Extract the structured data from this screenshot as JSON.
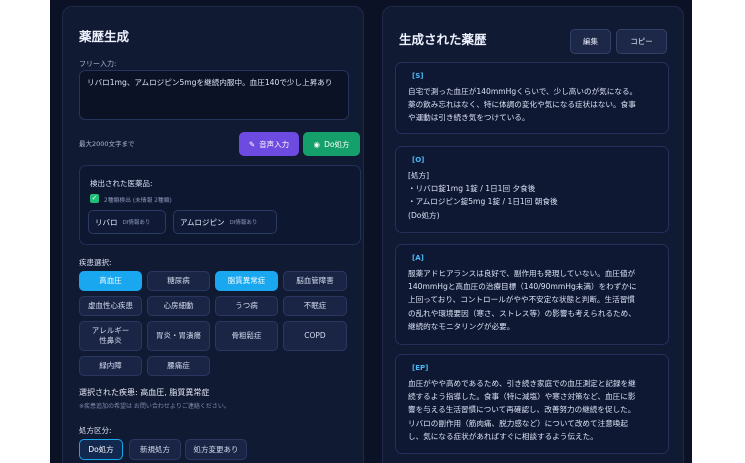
{
  "left_panel": {
    "title": "薬歴生成",
    "free_input_label": "フリー入力:",
    "free_input_value": "リバロ1mg、アムロジピン5mgを継続内服中。血圧140で少し上昇あり",
    "char_limit": "最大2000文字まで",
    "voice_button": "音声入力",
    "do_button": "Do処方",
    "detected_title": "検出された医薬品:",
    "detected_check_label": "2種類検出 (未情報 2種類)",
    "drugs": [
      {
        "name": "リバロ",
        "status": "DI情報あり"
      },
      {
        "name": "アムロジピン",
        "status": "DI情報あり"
      }
    ],
    "disease_label": "疾患選択:",
    "diseases": [
      "高血圧",
      "糖尿病",
      "脂質異常症",
      "脳血管障害",
      "虚血性心疾患",
      "心房細動",
      "うつ病",
      "不眠症",
      "アレルギー性鼻炎",
      "胃炎・胃潰瘍",
      "骨粗鬆症",
      "COPD",
      "緑内障",
      "腰痛症"
    ],
    "selected_diseases": "選択された疾患: 高血圧, 脂質異常症",
    "disease_note": "※疾患追加の希望は お問い合わせよりご連絡ください。",
    "rx_label": "処方区分:",
    "rx_tabs": [
      "Do処方",
      "新規処方",
      "処方変更あり"
    ]
  },
  "right_panel": {
    "title": "生成された薬歴",
    "edit_button": "編集",
    "copy_button": "コピー",
    "sections": [
      {
        "tag": "[S]",
        "lines": [
          "自宅で測った血圧が140mmHgくらいで、少し高いのが気になる。",
          "薬の飲み忘れはなく、特に体調の変化や気になる症状はない。食事",
          "や運動は引き続き気をつけている。"
        ]
      },
      {
        "tag": "[O]",
        "lines": [
          "[処方]",
          "・リバロ錠1mg 1錠 / 1日1回 夕食後",
          "・アムロジピン錠5mg 1錠 / 1日1回 朝食後",
          "(Do処方)"
        ]
      },
      {
        "tag": "[A]",
        "lines": [
          "服薬アドヒアランスは良好で、副作用も発現していない。血圧値が",
          "140mmHgと高血圧の治療目標（140/90mmHg未満）をわずかに",
          "上回っており、コントロールがやや不安定な状態と判断。生活習慣",
          "の乱れや環境要因（寒さ、ストレス等）の影響も考えられるため、",
          "継続的なモニタリングが必要。"
        ]
      },
      {
        "tag": "[EP]",
        "lines": [
          "血圧がやや高めであるため、引き続き家庭での血圧測定と記録を継",
          "続するよう指導した。食事（特に減塩）や寒さ対策など、血圧に影",
          "響を与える生活習慣について再確認し、改善努力の継続を促した。",
          "リバロの副作用（筋肉痛、脱力感など）について改めて注意喚起",
          "し、気になる症状があればすぐに相談するよう伝えた。"
        ]
      }
    ]
  }
}
